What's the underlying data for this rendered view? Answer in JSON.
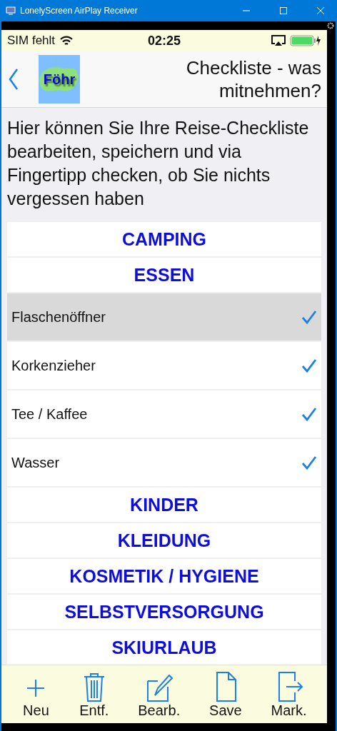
{
  "window": {
    "title": "LonelyScreen AirPlay Receiver"
  },
  "status_bar": {
    "carrier": "SIM fehlt",
    "time": "02:25"
  },
  "nav": {
    "logo_text": "Föhr",
    "title": "Checkliste - was mitnehmen?"
  },
  "intro": "Hier können Sie Ihre Reise-Checkliste bearbeiten, speichern und via Fingertipp checken, ob Sie nichts vergessen haben",
  "sections": [
    {
      "title": "CAMPING"
    },
    {
      "title": "ESSEN",
      "items": [
        {
          "label": "Flaschenöffner",
          "checked": true,
          "selected": true
        },
        {
          "label": "Korkenzieher",
          "checked": true,
          "selected": false
        },
        {
          "label": "Tee / Kaffee",
          "checked": true,
          "selected": false
        },
        {
          "label": "Wasser",
          "checked": true,
          "selected": false
        }
      ]
    },
    {
      "title": "KINDER"
    },
    {
      "title": "KLEIDUNG"
    },
    {
      "title": "KOSMETIK / HYGIENE"
    },
    {
      "title": "SELBSTVERSORGUNG"
    },
    {
      "title": "SKIURLAUB"
    }
  ],
  "toolbar": [
    {
      "kind": "add",
      "label": "Neu"
    },
    {
      "kind": "trash",
      "label": "Entf."
    },
    {
      "kind": "edit",
      "label": "Bearb."
    },
    {
      "kind": "save",
      "label": "Save"
    },
    {
      "kind": "export",
      "label": "Mark."
    }
  ]
}
